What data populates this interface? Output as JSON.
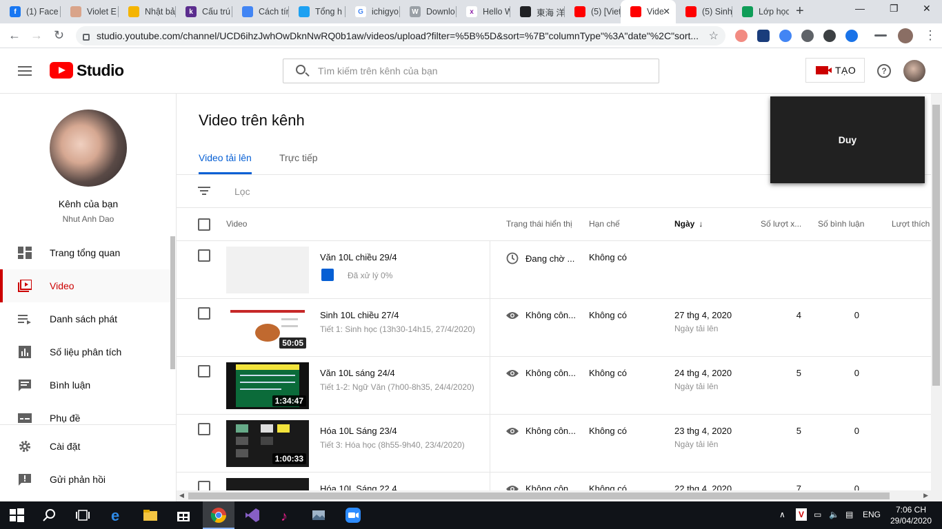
{
  "browser": {
    "tabs": [
      {
        "label": "(1) Face",
        "color": "#1877f2",
        "glyph": "f"
      },
      {
        "label": "Violet E",
        "color": "#d9a48a",
        "glyph": ""
      },
      {
        "label": "Nhật bả",
        "color": "#f4b400",
        "glyph": ""
      },
      {
        "label": "Cấu trú",
        "color": "#5b2d8e",
        "glyph": "k"
      },
      {
        "label": "Cách tír",
        "color": "#4285f4",
        "glyph": ""
      },
      {
        "label": "Tổng h",
        "color": "#1da1f2",
        "glyph": ""
      },
      {
        "label": "ichigyo",
        "color": "#ffffff",
        "glyph": "G"
      },
      {
        "label": "Downlo",
        "color": "#9aa0a6",
        "glyph": "W"
      },
      {
        "label": "Hello W",
        "color": "#ffffff",
        "glyph": "x"
      },
      {
        "label": "東海 洋",
        "color": "#202124",
        "glyph": ""
      },
      {
        "label": "(5) [Viet",
        "color": "#ff0000",
        "glyph": ""
      },
      {
        "label": "Vide",
        "color": "#ff0000",
        "glyph": ""
      },
      {
        "label": "(5) Sinh",
        "color": "#ff0000",
        "glyph": ""
      },
      {
        "label": "Lớp học",
        "color": "#0f9d58",
        "glyph": ""
      }
    ],
    "new_tab": "+",
    "url": "studio.youtube.com/channel/UCD6ihzJwhOwDknNwRQ0b1aw/videos/upload?filter=%5B%5D&sort=%7B\"columnType\"%3A\"date\"%2C\"sort..."
  },
  "studio": {
    "logo_text": "Studio",
    "search_placeholder": "Tìm kiếm trên kênh của bạn",
    "create_label": "TẠO",
    "help_glyph": "?"
  },
  "sidebar": {
    "channel_title": "Kênh của bạn",
    "channel_name": "Nhut Anh Dao",
    "items": [
      {
        "label": "Trang tổng quan",
        "icon": "dashboard-icon"
      },
      {
        "label": "Video",
        "icon": "video-icon"
      },
      {
        "label": "Danh sách phát",
        "icon": "playlist-icon"
      },
      {
        "label": "Số liệu phân tích",
        "icon": "analytics-icon"
      },
      {
        "label": "Bình luận",
        "icon": "comments-icon"
      },
      {
        "label": "Phụ đề",
        "icon": "subtitles-icon"
      }
    ],
    "footer_items": [
      {
        "label": "Cài đặt",
        "icon": "settings-icon"
      },
      {
        "label": "Gửi phản hồi",
        "icon": "feedback-icon"
      }
    ]
  },
  "main": {
    "title": "Video trên kênh",
    "tabs": [
      "Video tải lên",
      "Trực tiếp"
    ],
    "filter_label": "Lọc",
    "columns": {
      "video": "Video",
      "visibility": "Trạng thái hiển thị",
      "restrictions": "Hạn chế",
      "date": "Ngày",
      "views": "Số lượt x...",
      "comments": "Số bình luận",
      "likes": "Lượt thích"
    },
    "rows": [
      {
        "title": "Văn 10L chiều 29/4",
        "desc": "",
        "processing": "Đã xử lý 0%",
        "duration": "",
        "visibility": "Đang chờ ...",
        "restrictions": "Không có",
        "date": "",
        "date_sub": "",
        "views": "",
        "comments": ""
      },
      {
        "title": "Sinh 10L chiều 27/4",
        "desc": "Tiết 1: Sinh học (13h30-14h15, 27/4/2020)",
        "processing": "",
        "duration": "50:05",
        "visibility": "Không côn...",
        "restrictions": "Không có",
        "date": "27 thg 4, 2020",
        "date_sub": "Ngày tải lên",
        "views": "4",
        "comments": "0"
      },
      {
        "title": "Văn 10L sáng 24/4",
        "desc": "Tiết 1-2: Ngữ Văn (7h00-8h35, 24/4/2020)",
        "processing": "",
        "duration": "1:34:47",
        "visibility": "Không côn...",
        "restrictions": "Không có",
        "date": "24 thg 4, 2020",
        "date_sub": "Ngày tải lên",
        "views": "5",
        "comments": "0"
      },
      {
        "title": "Hóa 10L Sáng 23/4",
        "desc": "Tiết 3: Hóa học (8h55-9h40, 23/4/2020)",
        "processing": "",
        "duration": "1:00:33",
        "visibility": "Không côn...",
        "restrictions": "Không có",
        "date": "23 thg 4, 2020",
        "date_sub": "Ngày tải lên",
        "views": "5",
        "comments": "0"
      },
      {
        "title": "Hóa 10L Sáng 22 4",
        "desc": "",
        "processing": "",
        "duration": "",
        "visibility": "Không côn...",
        "restrictions": "Không có",
        "date": "22 thg 4, 2020",
        "date_sub": "",
        "views": "7",
        "comments": "0"
      }
    ]
  },
  "popup": {
    "label": "Duy"
  },
  "taskbar": {
    "time": "7:06 CH",
    "date": "29/04/2020",
    "lang": "ENG"
  },
  "colors": {
    "accent": "#065fd4",
    "brand": "#ff0000",
    "active_nav": "#cc0000"
  }
}
